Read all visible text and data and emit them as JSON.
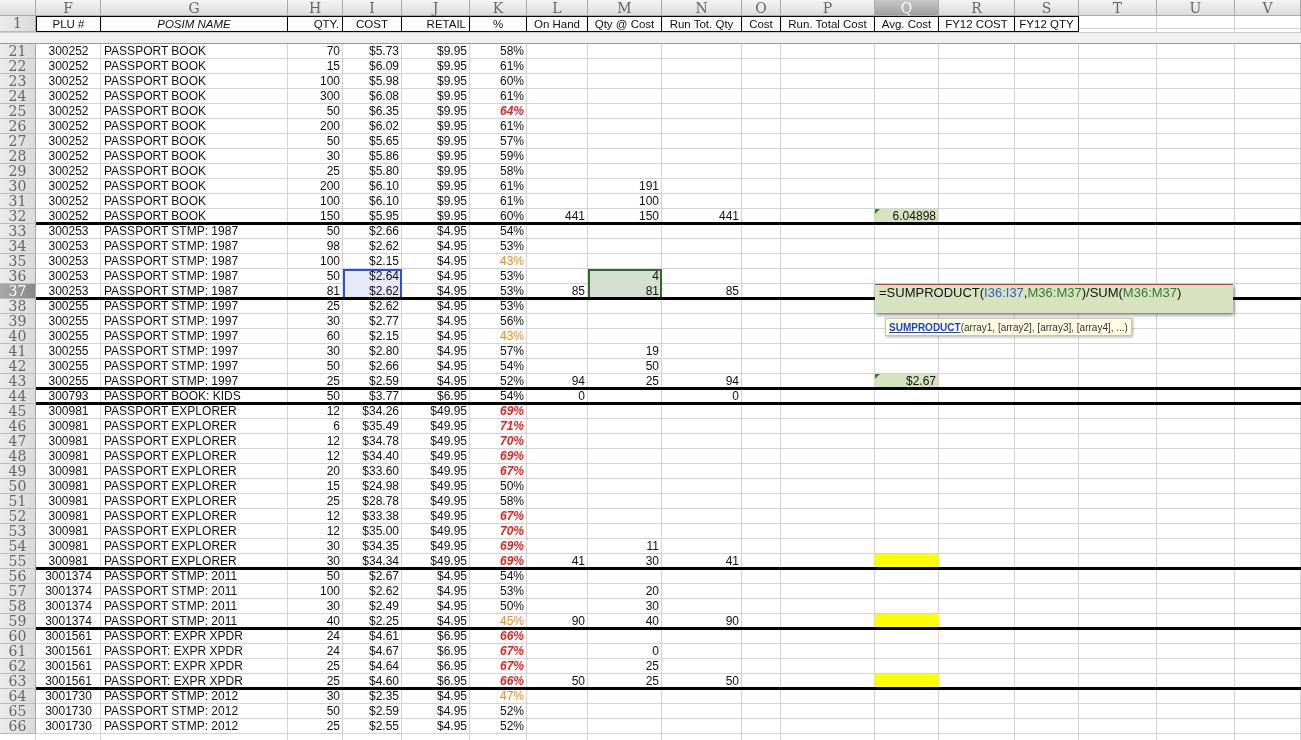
{
  "column_letters": [
    {
      "label": "F",
      "selected": false
    },
    {
      "label": "G",
      "selected": false
    },
    {
      "label": "H",
      "selected": false
    },
    {
      "label": "I",
      "selected": false
    },
    {
      "label": "J",
      "selected": false
    },
    {
      "label": "K",
      "selected": false
    },
    {
      "label": "L",
      "selected": false
    },
    {
      "label": "M",
      "selected": false
    },
    {
      "label": "N",
      "selected": false
    },
    {
      "label": "O",
      "selected": false
    },
    {
      "label": "P",
      "selected": false
    },
    {
      "label": "Q",
      "selected": true
    },
    {
      "label": "R",
      "selected": false
    },
    {
      "label": "S",
      "selected": false
    },
    {
      "label": "T",
      "selected": false
    },
    {
      "label": "U",
      "selected": false
    },
    {
      "label": "V",
      "selected": false
    }
  ],
  "header_row": {
    "row": "1",
    "titles": [
      {
        "text": "PLU #",
        "italic": false
      },
      {
        "text": "POSIM  NAME",
        "italic": true
      },
      {
        "text": "QTY.",
        "italic": false
      },
      {
        "text": "COST",
        "italic": false
      },
      {
        "text": "RETAIL",
        "italic": false
      },
      {
        "text": "%",
        "italic": false
      },
      {
        "text": "On Hand",
        "italic": false
      },
      {
        "text": "Qty @ Cost",
        "italic": false
      },
      {
        "text": "Run Tot. Qty",
        "italic": false
      },
      {
        "text": "Cost",
        "italic": false
      },
      {
        "text": "Run. Total Cost",
        "italic": false
      },
      {
        "text": "Avg. Cost",
        "italic": false
      },
      {
        "text": "FY12 COST",
        "italic": false
      },
      {
        "text": "FY12 QTY",
        "italic": false
      }
    ]
  },
  "rows": [
    {
      "row": "21",
      "selected": false,
      "cost_selected": false,
      "ref_highlighted": false,
      "group_end": false,
      "plu": "300252",
      "name": "PASSPORT BOOK",
      "qty": "70",
      "cost": "$5.73",
      "retail": "$9.95",
      "margin": {
        "text": "58%",
        "kind": "normal"
      }
    },
    {
      "row": "22",
      "selected": false,
      "cost_selected": false,
      "ref_highlighted": false,
      "group_end": false,
      "plu": "300252",
      "name": "PASSPORT BOOK",
      "qty": "15",
      "cost": "$6.09",
      "retail": "$9.95",
      "margin": {
        "text": "61%",
        "kind": "normal"
      }
    },
    {
      "row": "23",
      "selected": false,
      "cost_selected": false,
      "ref_highlighted": false,
      "group_end": false,
      "plu": "300252",
      "name": "PASSPORT BOOK",
      "qty": "100",
      "cost": "$5.98",
      "retail": "$9.95",
      "margin": {
        "text": "60%",
        "kind": "normal"
      }
    },
    {
      "row": "24",
      "selected": false,
      "cost_selected": false,
      "ref_highlighted": false,
      "group_end": false,
      "plu": "300252",
      "name": "PASSPORT BOOK",
      "qty": "300",
      "cost": "$6.08",
      "retail": "$9.95",
      "margin": {
        "text": "61%",
        "kind": "normal"
      }
    },
    {
      "row": "25",
      "selected": false,
      "cost_selected": false,
      "ref_highlighted": false,
      "group_end": false,
      "plu": "300252",
      "name": "PASSPORT BOOK",
      "qty": "50",
      "cost": "$6.35",
      "retail": "$9.95",
      "margin": {
        "text": "64%",
        "kind": "high"
      }
    },
    {
      "row": "26",
      "selected": false,
      "cost_selected": false,
      "ref_highlighted": false,
      "group_end": false,
      "plu": "300252",
      "name": "PASSPORT BOOK",
      "qty": "200",
      "cost": "$6.02",
      "retail": "$9.95",
      "margin": {
        "text": "61%",
        "kind": "normal"
      }
    },
    {
      "row": "27",
      "selected": false,
      "cost_selected": false,
      "ref_highlighted": false,
      "group_end": false,
      "plu": "300252",
      "name": "PASSPORT BOOK",
      "qty": "50",
      "cost": "$5.65",
      "retail": "$9.95",
      "margin": {
        "text": "57%",
        "kind": "normal"
      }
    },
    {
      "row": "28",
      "selected": false,
      "cost_selected": false,
      "ref_highlighted": false,
      "group_end": false,
      "plu": "300252",
      "name": "PASSPORT BOOK",
      "qty": "30",
      "cost": "$5.86",
      "retail": "$9.95",
      "margin": {
        "text": "59%",
        "kind": "normal"
      }
    },
    {
      "row": "29",
      "selected": false,
      "cost_selected": false,
      "ref_highlighted": false,
      "group_end": false,
      "plu": "300252",
      "name": "PASSPORT BOOK",
      "qty": "25",
      "cost": "$5.80",
      "retail": "$9.95",
      "margin": {
        "text": "58%",
        "kind": "normal"
      }
    },
    {
      "row": "30",
      "selected": false,
      "cost_selected": false,
      "ref_highlighted": false,
      "group_end": false,
      "plu": "300252",
      "name": "PASSPORT BOOK",
      "qty": "200",
      "cost": "$6.10",
      "retail": "$9.95",
      "margin": {
        "text": "61%",
        "kind": "normal"
      },
      "qty_at_cost": "191"
    },
    {
      "row": "31",
      "selected": false,
      "cost_selected": false,
      "ref_highlighted": false,
      "group_end": false,
      "plu": "300252",
      "name": "PASSPORT BOOK",
      "qty": "100",
      "cost": "$6.10",
      "retail": "$9.95",
      "margin": {
        "text": "61%",
        "kind": "normal"
      },
      "qty_at_cost": "100"
    },
    {
      "row": "32",
      "selected": false,
      "cost_selected": false,
      "ref_highlighted": false,
      "group_end": true,
      "plu": "300252",
      "name": "PASSPORT BOOK",
      "qty": "150",
      "cost": "$5.95",
      "retail": "$9.95",
      "margin": {
        "text": "60%",
        "kind": "normal"
      },
      "on_hand": "441",
      "qty_at_cost": "150",
      "run_tot_qty": "441",
      "avg_cost": {
        "kind": "flagged",
        "text": "6.04898"
      }
    },
    {
      "row": "33",
      "selected": false,
      "cost_selected": false,
      "ref_highlighted": false,
      "group_end": false,
      "plu": "300253",
      "name": "PASSPORT STMP: 1987",
      "qty": "50",
      "cost": "$2.66",
      "retail": "$4.95",
      "margin": {
        "text": "54%",
        "kind": "normal"
      }
    },
    {
      "row": "34",
      "selected": false,
      "cost_selected": false,
      "ref_highlighted": false,
      "group_end": false,
      "plu": "300253",
      "name": "PASSPORT STMP: 1987",
      "qty": "98",
      "cost": "$2.62",
      "retail": "$4.95",
      "margin": {
        "text": "53%",
        "kind": "normal"
      }
    },
    {
      "row": "35",
      "selected": false,
      "cost_selected": false,
      "ref_highlighted": false,
      "group_end": false,
      "plu": "300253",
      "name": "PASSPORT STMP: 1987",
      "qty": "100",
      "cost": "$2.15",
      "retail": "$4.95",
      "margin": {
        "text": "43%",
        "kind": "low"
      }
    },
    {
      "row": "36",
      "selected": false,
      "cost_selected": true,
      "ref_highlighted": true,
      "group_end": false,
      "plu": "300253",
      "name": "PASSPORT STMP: 1987",
      "qty": "50",
      "cost": "$2.64",
      "retail": "$4.95",
      "margin": {
        "text": "53%",
        "kind": "normal"
      },
      "qty_at_cost": "4"
    },
    {
      "row": "37",
      "selected": true,
      "cost_selected": true,
      "ref_highlighted": true,
      "group_end": true,
      "plu": "300253",
      "name": "PASSPORT STMP: 1987",
      "qty": "81",
      "cost": "$2.62",
      "retail": "$4.95",
      "margin": {
        "text": "53%",
        "kind": "normal"
      },
      "on_hand": "85",
      "qty_at_cost": "81",
      "run_tot_qty": "85"
    },
    {
      "row": "38",
      "selected": false,
      "cost_selected": false,
      "ref_highlighted": false,
      "group_end": false,
      "plu": "300255",
      "name": "PASSPORT STMP: 1997",
      "qty": "25",
      "cost": "$2.62",
      "retail": "$4.95",
      "margin": {
        "text": "53%",
        "kind": "normal"
      }
    },
    {
      "row": "39",
      "selected": false,
      "cost_selected": false,
      "ref_highlighted": false,
      "group_end": false,
      "plu": "300255",
      "name": "PASSPORT STMP: 1997",
      "qty": "30",
      "cost": "$2.77",
      "retail": "$4.95",
      "margin": {
        "text": "56%",
        "kind": "normal"
      }
    },
    {
      "row": "40",
      "selected": false,
      "cost_selected": false,
      "ref_highlighted": false,
      "group_end": false,
      "plu": "300255",
      "name": "PASSPORT STMP: 1997",
      "qty": "60",
      "cost": "$2.15",
      "retail": "$4.95",
      "margin": {
        "text": "43%",
        "kind": "low"
      }
    },
    {
      "row": "41",
      "selected": false,
      "cost_selected": false,
      "ref_highlighted": false,
      "group_end": false,
      "plu": "300255",
      "name": "PASSPORT STMP: 1997",
      "qty": "30",
      "cost": "$2.80",
      "retail": "$4.95",
      "margin": {
        "text": "57%",
        "kind": "normal"
      },
      "qty_at_cost": "19"
    },
    {
      "row": "42",
      "selected": false,
      "cost_selected": false,
      "ref_highlighted": false,
      "group_end": false,
      "plu": "300255",
      "name": "PASSPORT STMP: 1997",
      "qty": "50",
      "cost": "$2.66",
      "retail": "$4.95",
      "margin": {
        "text": "54%",
        "kind": "normal"
      },
      "qty_at_cost": "50"
    },
    {
      "row": "43",
      "selected": false,
      "cost_selected": false,
      "ref_highlighted": false,
      "group_end": true,
      "plu": "300255",
      "name": "PASSPORT STMP: 1997",
      "qty": "25",
      "cost": "$2.59",
      "retail": "$4.95",
      "margin": {
        "text": "52%",
        "kind": "normal"
      },
      "on_hand": "94",
      "qty_at_cost": "25",
      "run_tot_qty": "94",
      "avg_cost": {
        "kind": "flagged",
        "text": "$2.67"
      }
    },
    {
      "row": "44",
      "selected": false,
      "cost_selected": false,
      "ref_highlighted": false,
      "group_end": true,
      "plu": "300793",
      "name": "PASSPORT BOOK: KIDS",
      "qty": "50",
      "cost": "$3.77",
      "retail": "$6.95",
      "margin": {
        "text": "54%",
        "kind": "normal"
      },
      "on_hand": "0",
      "run_tot_qty": "0"
    },
    {
      "row": "45",
      "selected": false,
      "cost_selected": false,
      "ref_highlighted": false,
      "group_end": false,
      "plu": "300981",
      "name": "PASSPORT EXPLORER",
      "qty": "12",
      "cost": "$34.26",
      "retail": "$49.95",
      "margin": {
        "text": "69%",
        "kind": "high"
      }
    },
    {
      "row": "46",
      "selected": false,
      "cost_selected": false,
      "ref_highlighted": false,
      "group_end": false,
      "plu": "300981",
      "name": "PASSPORT EXPLORER",
      "qty": "6",
      "cost": "$35.49",
      "retail": "$49.95",
      "margin": {
        "text": "71%",
        "kind": "high"
      }
    },
    {
      "row": "47",
      "selected": false,
      "cost_selected": false,
      "ref_highlighted": false,
      "group_end": false,
      "plu": "300981",
      "name": "PASSPORT EXPLORER",
      "qty": "12",
      "cost": "$34.78",
      "retail": "$49.95",
      "margin": {
        "text": "70%",
        "kind": "high"
      }
    },
    {
      "row": "48",
      "selected": false,
      "cost_selected": false,
      "ref_highlighted": false,
      "group_end": false,
      "plu": "300981",
      "name": "PASSPORT EXPLORER",
      "qty": "12",
      "cost": "$34.40",
      "retail": "$49.95",
      "margin": {
        "text": "69%",
        "kind": "high"
      }
    },
    {
      "row": "49",
      "selected": false,
      "cost_selected": false,
      "ref_highlighted": false,
      "group_end": false,
      "plu": "300981",
      "name": "PASSPORT EXPLORER",
      "qty": "20",
      "cost": "$33.60",
      "retail": "$49.95",
      "margin": {
        "text": "67%",
        "kind": "high"
      }
    },
    {
      "row": "50",
      "selected": false,
      "cost_selected": false,
      "ref_highlighted": false,
      "group_end": false,
      "plu": "300981",
      "name": "PASSPORT EXPLORER",
      "qty": "15",
      "cost": "$24.98",
      "retail": "$49.95",
      "margin": {
        "text": "50%",
        "kind": "normal"
      }
    },
    {
      "row": "51",
      "selected": false,
      "cost_selected": false,
      "ref_highlighted": false,
      "group_end": false,
      "plu": "300981",
      "name": "PASSPORT EXPLORER",
      "qty": "25",
      "cost": "$28.78",
      "retail": "$49.95",
      "margin": {
        "text": "58%",
        "kind": "normal"
      }
    },
    {
      "row": "52",
      "selected": false,
      "cost_selected": false,
      "ref_highlighted": false,
      "group_end": false,
      "plu": "300981",
      "name": "PASSPORT EXPLORER",
      "qty": "12",
      "cost": "$33.38",
      "retail": "$49.95",
      "margin": {
        "text": "67%",
        "kind": "high"
      }
    },
    {
      "row": "53",
      "selected": false,
      "cost_selected": false,
      "ref_highlighted": false,
      "group_end": false,
      "plu": "300981",
      "name": "PASSPORT EXPLORER",
      "qty": "12",
      "cost": "$35.00",
      "retail": "$49.95",
      "margin": {
        "text": "70%",
        "kind": "high"
      }
    },
    {
      "row": "54",
      "selected": false,
      "cost_selected": false,
      "ref_highlighted": false,
      "group_end": false,
      "plu": "300981",
      "name": "PASSPORT EXPLORER",
      "qty": "30",
      "cost": "$34.35",
      "retail": "$49.95",
      "margin": {
        "text": "69%",
        "kind": "high"
      },
      "qty_at_cost": "11"
    },
    {
      "row": "55",
      "selected": false,
      "cost_selected": false,
      "ref_highlighted": false,
      "group_end": true,
      "plu": "300981",
      "name": "PASSPORT EXPLORER",
      "qty": "30",
      "cost": "$34.34",
      "retail": "$49.95",
      "margin": {
        "text": "69%",
        "kind": "high"
      },
      "on_hand": "41",
      "qty_at_cost": "30",
      "run_tot_qty": "41",
      "avg_cost": {
        "kind": "highlight"
      }
    },
    {
      "row": "56",
      "selected": false,
      "cost_selected": false,
      "ref_highlighted": false,
      "group_end": false,
      "plu": "3001374",
      "name": "PASSPORT STMP: 2011",
      "qty": "50",
      "cost": "$2.67",
      "retail": "$4.95",
      "margin": {
        "text": "54%",
        "kind": "normal"
      }
    },
    {
      "row": "57",
      "selected": false,
      "cost_selected": false,
      "ref_highlighted": false,
      "group_end": false,
      "plu": "3001374",
      "name": "PASSPORT STMP: 2011",
      "qty": "100",
      "cost": "$2.62",
      "retail": "$4.95",
      "margin": {
        "text": "53%",
        "kind": "normal"
      },
      "qty_at_cost": "20"
    },
    {
      "row": "58",
      "selected": false,
      "cost_selected": false,
      "ref_highlighted": false,
      "group_end": false,
      "plu": "3001374",
      "name": "PASSPORT STMP: 2011",
      "qty": "30",
      "cost": "$2.49",
      "retail": "$4.95",
      "margin": {
        "text": "50%",
        "kind": "normal"
      },
      "qty_at_cost": "30"
    },
    {
      "row": "59",
      "selected": false,
      "cost_selected": false,
      "ref_highlighted": false,
      "group_end": true,
      "plu": "3001374",
      "name": "PASSPORT STMP: 2011",
      "qty": "40",
      "cost": "$2.25",
      "retail": "$4.95",
      "margin": {
        "text": "45%",
        "kind": "low"
      },
      "on_hand": "90",
      "qty_at_cost": "40",
      "run_tot_qty": "90",
      "avg_cost": {
        "kind": "highlight"
      }
    },
    {
      "row": "60",
      "selected": false,
      "cost_selected": false,
      "ref_highlighted": false,
      "group_end": false,
      "plu": "3001561",
      "name": "PASSPORT: EXPR XPDR",
      "qty": "24",
      "cost": "$4.61",
      "retail": "$6.95",
      "margin": {
        "text": "66%",
        "kind": "high"
      }
    },
    {
      "row": "61",
      "selected": false,
      "cost_selected": false,
      "ref_highlighted": false,
      "group_end": false,
      "plu": "3001561",
      "name": "PASSPORT: EXPR XPDR",
      "qty": "24",
      "cost": "$4.67",
      "retail": "$6.95",
      "margin": {
        "text": "67%",
        "kind": "high"
      },
      "qty_at_cost": "0"
    },
    {
      "row": "62",
      "selected": false,
      "cost_selected": false,
      "ref_highlighted": false,
      "group_end": false,
      "plu": "3001561",
      "name": "PASSPORT: EXPR XPDR",
      "qty": "25",
      "cost": "$4.64",
      "retail": "$6.95",
      "margin": {
        "text": "67%",
        "kind": "high"
      },
      "qty_at_cost": "25"
    },
    {
      "row": "63",
      "selected": false,
      "cost_selected": false,
      "ref_highlighted": false,
      "group_end": true,
      "plu": "3001561",
      "name": "PASSPORT: EXPR XPDR",
      "qty": "25",
      "cost": "$4.60",
      "retail": "$6.95",
      "margin": {
        "text": "66%",
        "kind": "high"
      },
      "on_hand": "50",
      "qty_at_cost": "25",
      "run_tot_qty": "50",
      "avg_cost": {
        "kind": "highlight"
      }
    },
    {
      "row": "64",
      "selected": false,
      "cost_selected": false,
      "ref_highlighted": false,
      "group_end": false,
      "plu": "3001730",
      "name": "PASSPORT STMP: 2012",
      "qty": "30",
      "cost": "$2.35",
      "retail": "$4.95",
      "margin": {
        "text": "47%",
        "kind": "low"
      }
    },
    {
      "row": "65",
      "selected": false,
      "cost_selected": false,
      "ref_highlighted": false,
      "group_end": false,
      "plu": "3001730",
      "name": "PASSPORT STMP: 2012",
      "qty": "50",
      "cost": "$2.59",
      "retail": "$4.95",
      "margin": {
        "text": "52%",
        "kind": "normal"
      }
    },
    {
      "row": "66",
      "selected": false,
      "cost_selected": false,
      "ref_highlighted": false,
      "group_end": false,
      "plu": "3001730",
      "name": "PASSPORT STMP: 2012",
      "qty": "25",
      "cost": "$2.55",
      "retail": "$4.95",
      "margin": {
        "text": "52%",
        "kind": "normal"
      }
    }
  ],
  "formula_editor": {
    "parts": [
      {
        "text": "=SUMPRODUCT(",
        "kind": "plain"
      },
      {
        "text": "I36:I37",
        "kind": "ref",
        "color": "#2f5fd0"
      },
      {
        "text": ",",
        "kind": "plain"
      },
      {
        "text": "M36:M37",
        "kind": "ref",
        "color": "#2e7d32"
      },
      {
        "text": ")/SUM(",
        "kind": "plain"
      },
      {
        "text": "M36:M37",
        "kind": "ref",
        "color": "#2e7d32"
      },
      {
        "text": ")",
        "kind": "plain"
      }
    ]
  },
  "function_tooltip": {
    "function": "SUMPRODUCT",
    "arguments": "(array1, [array2], [array3], [array4], ...)"
  }
}
